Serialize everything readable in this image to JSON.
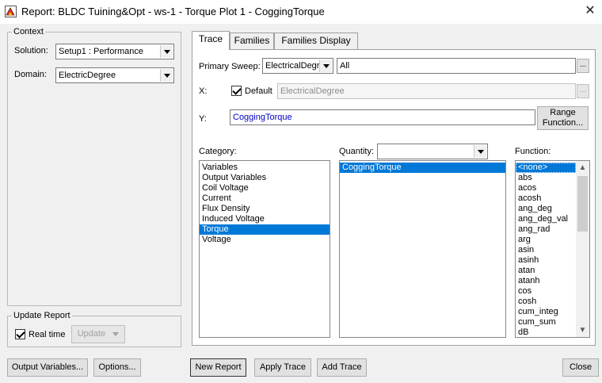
{
  "window": {
    "title": "Report: BLDC Tuining&Opt - ws-1 - Torque Plot 1 - CoggingTorque",
    "close_glyph": "✕"
  },
  "context": {
    "legend": "Context",
    "solution_label": "Solution:",
    "solution_value": "Setup1 : Performance",
    "domain_label": "Domain:",
    "domain_value": "ElectricDegree"
  },
  "update_report": {
    "legend": "Update Report",
    "realtime_label": "Real time",
    "realtime_checked": true,
    "update_label": "Update"
  },
  "tabs": [
    {
      "label": "Trace",
      "active": true
    },
    {
      "label": "Families",
      "active": false
    },
    {
      "label": "Families Display",
      "active": false
    }
  ],
  "trace": {
    "primary_sweep_label": "Primary Sweep:",
    "primary_sweep_value": "ElectricalDegre",
    "primary_sweep_range": "All",
    "ellipsis": "...",
    "x_label": "X:",
    "x_default_label": "Default",
    "x_default_checked": true,
    "x_value": "ElectricalDegree",
    "y_label": "Y:",
    "y_value": "CoggingTorque",
    "range_function_line1": "Range",
    "range_function_line2": "Function..."
  },
  "category": {
    "label": "Category:",
    "items": [
      "Variables",
      "Output Variables",
      "Coil Voltage",
      "Current",
      "Flux Density",
      "Induced Voltage",
      "Torque",
      "Voltage"
    ],
    "selected": "Torque"
  },
  "quantity": {
    "label": "Quantity:",
    "filter_value": "",
    "items": [
      "CoggingTorque"
    ],
    "selected": "CoggingTorque"
  },
  "function": {
    "label": "Function:",
    "items": [
      "<none>",
      "abs",
      "acos",
      "acosh",
      "ang_deg",
      "ang_deg_val",
      "ang_rad",
      "arg",
      "asin",
      "asinh",
      "atan",
      "atanh",
      "cos",
      "cosh",
      "cum_integ",
      "cum_sum",
      "dB"
    ],
    "selected": "<none>"
  },
  "buttons": {
    "output_variables": "Output Variables...",
    "options": "Options...",
    "new_report": "New Report",
    "apply_trace": "Apply Trace",
    "add_trace": "Add Trace",
    "close": "Close"
  },
  "colors": {
    "selection": "#0078d7",
    "y_text": "#0000c8"
  }
}
